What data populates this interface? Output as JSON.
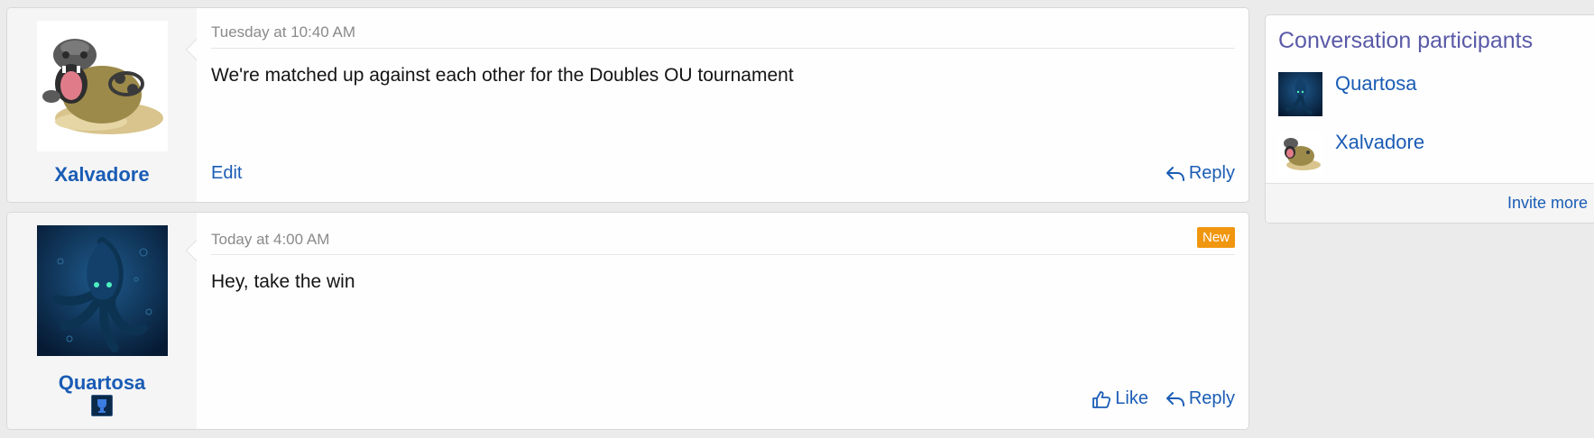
{
  "messages": [
    {
      "username": "Xalvadore",
      "avatar": "hippowdon-avatar",
      "timestamp": "Tuesday at 10:40 AM",
      "text": "We're matched up against each other for the Doubles OU tournament",
      "actions": {
        "edit": "Edit",
        "reply": "Reply"
      }
    },
    {
      "username": "Quartosa",
      "avatar": "kraken-avatar",
      "timestamp": "Today at 4:00 AM",
      "badge": "New",
      "text": "Hey, take the win",
      "actions": {
        "like": "Like",
        "reply": "Reply"
      }
    }
  ],
  "sidebar": {
    "title": "Conversation participants",
    "participants": [
      {
        "name": "Quartosa",
        "avatar": "kraken-avatar"
      },
      {
        "name": "Xalvadore",
        "avatar": "hippowdon-avatar"
      }
    ],
    "invite_label": "Invite more"
  },
  "colors": {
    "link": "#1a5cb5",
    "sidebar_title": "#5a5aa8",
    "new_badge": "#f0960f",
    "page_background": "#ebebeb"
  }
}
